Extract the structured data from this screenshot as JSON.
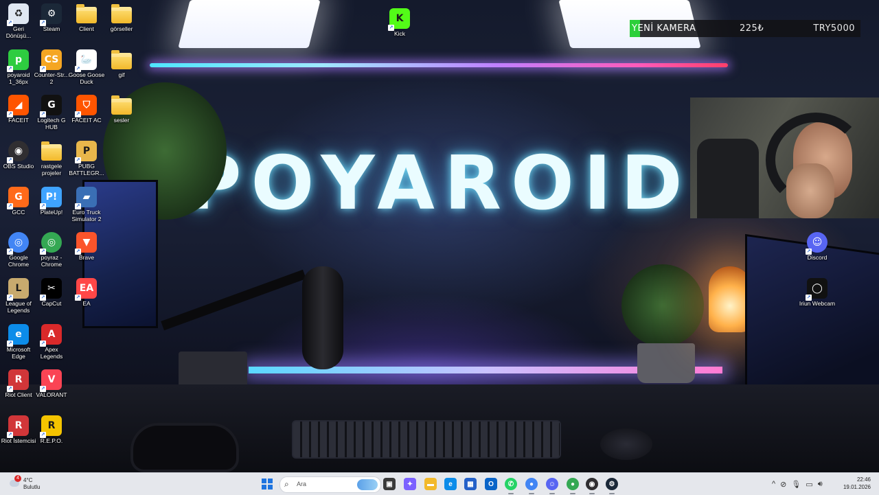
{
  "wallpaper": {
    "brand_text": "POYAROID"
  },
  "desktop_icons": [
    {
      "label": "Geri Dönüşü...",
      "icon": "recycle-bin-icon",
      "color": "#dfe7f2"
    },
    {
      "label": "Steam",
      "icon": "steam-icon",
      "color": "#1b2838"
    },
    {
      "label": "Client",
      "icon": "folder-icon",
      "color": "#f2b92b"
    },
    {
      "label": "görseller",
      "icon": "folder-icon",
      "color": "#f2b92b"
    },
    {
      "label": "Kick",
      "icon": "kick-icon",
      "color": "#53fc18"
    },
    {
      "label": "poyaroid 1_36px",
      "icon": "poyaroid-image-icon",
      "color": "#2ecc40"
    },
    {
      "label": "Counter-Str... 2",
      "icon": "counter-strike-icon",
      "color": "#f5a623"
    },
    {
      "label": "Goose Goose Duck",
      "icon": "goose-goose-duck-icon",
      "color": "#ffffff"
    },
    {
      "label": "gif",
      "icon": "folder-icon",
      "color": "#f2b92b"
    },
    {
      "label": "FACEIT",
      "icon": "faceit-icon",
      "color": "#ff5500"
    },
    {
      "label": "Logitech G HUB",
      "icon": "logitech-g-hub-icon",
      "color": "#111111"
    },
    {
      "label": "FACEIT AC",
      "icon": "faceit-ac-icon",
      "color": "#ff5500"
    },
    {
      "label": "sesler",
      "icon": "folder-icon",
      "color": "#f2b92b"
    },
    {
      "label": "OBS Studio",
      "icon": "obs-studio-icon",
      "color": "#302e31"
    },
    {
      "label": "rastgele projeler",
      "icon": "folder-icon",
      "color": "#f2b92b"
    },
    {
      "label": "PUBG BATTLEGR...",
      "icon": "pubg-icon",
      "color": "#e8b64b"
    },
    {
      "label": "GCC",
      "icon": "gcc-icon",
      "color": "#ff6a1a"
    },
    {
      "label": "PlateUp!",
      "icon": "plateup-icon",
      "color": "#3fa3ff"
    },
    {
      "label": "Euro Truck Simulator 2",
      "icon": "euro-truck-simulator-icon",
      "color": "#3a6fb5"
    },
    {
      "label": "Google Chrome",
      "icon": "google-chrome-icon",
      "color": "#4285f4"
    },
    {
      "label": "poyraz - Chrome",
      "icon": "chrome-profile-icon",
      "color": "#34a853"
    },
    {
      "label": "Brave",
      "icon": "brave-icon",
      "color": "#fb542b"
    },
    {
      "label": "League of Legends",
      "icon": "league-of-legends-icon",
      "color": "#c8aa6e"
    },
    {
      "label": "CapCut",
      "icon": "capcut-icon",
      "color": "#000000"
    },
    {
      "label": "EA",
      "icon": "ea-icon",
      "color": "#ff4747"
    },
    {
      "label": "Microsoft Edge",
      "icon": "microsoft-edge-icon",
      "color": "#0c8ce9"
    },
    {
      "label": "Apex Legends",
      "icon": "apex-legends-icon",
      "color": "#da292a"
    },
    {
      "label": "Riot Client",
      "icon": "riot-client-icon",
      "color": "#d13639"
    },
    {
      "label": "VALORANT",
      "icon": "valorant-icon",
      "color": "#fa4454"
    },
    {
      "label": "Riot İstemcisi",
      "icon": "riot-client-icon",
      "color": "#d13639"
    },
    {
      "label": "R.E.P.O.",
      "icon": "repo-icon",
      "color": "#f5c400"
    },
    {
      "label": "Discord",
      "icon": "discord-icon",
      "color": "#5865f2"
    },
    {
      "label": "Iriun Webcam",
      "icon": "iriun-webcam-icon",
      "color": "#111111"
    }
  ],
  "stream_overlay": {
    "label": "YENİ KAMERA",
    "amount": "225₺",
    "goal": "TRY5000",
    "accent_color": "#2ccf3a"
  },
  "taskbar": {
    "weather": {
      "temperature": "4°C",
      "condition": "Bulutlu",
      "badge_count": "4"
    },
    "search_placeholder": "Ara",
    "apps": [
      {
        "icon": "task-view-icon",
        "color": "#3a3a3a",
        "glyph": "▣"
      },
      {
        "icon": "copilot-icon",
        "color": "#7b61ff",
        "glyph": "✦"
      },
      {
        "icon": "file-explorer-icon",
        "color": "#f2b92b",
        "glyph": "▬"
      },
      {
        "icon": "microsoft-edge-icon",
        "color": "#0c8ce9",
        "glyph": "e"
      },
      {
        "icon": "microsoft-store-icon",
        "color": "#2460c8",
        "glyph": "▦"
      },
      {
        "icon": "outlook-icon",
        "color": "#0a64c8",
        "glyph": "O"
      },
      {
        "icon": "whatsapp-icon",
        "color": "#25d366",
        "glyph": "✆"
      },
      {
        "icon": "google-chrome-icon",
        "color": "#4285f4",
        "glyph": "●"
      },
      {
        "icon": "discord-icon",
        "color": "#5865f2",
        "glyph": "☺"
      },
      {
        "icon": "chrome-profile-icon",
        "color": "#34a853",
        "glyph": "●"
      },
      {
        "icon": "obs-studio-icon",
        "color": "#302e31",
        "glyph": "◉"
      },
      {
        "icon": "steam-icon",
        "color": "#1b2838",
        "glyph": "⚙"
      }
    ],
    "clock": {
      "time": "22:46",
      "date": "19.01.2026"
    }
  }
}
